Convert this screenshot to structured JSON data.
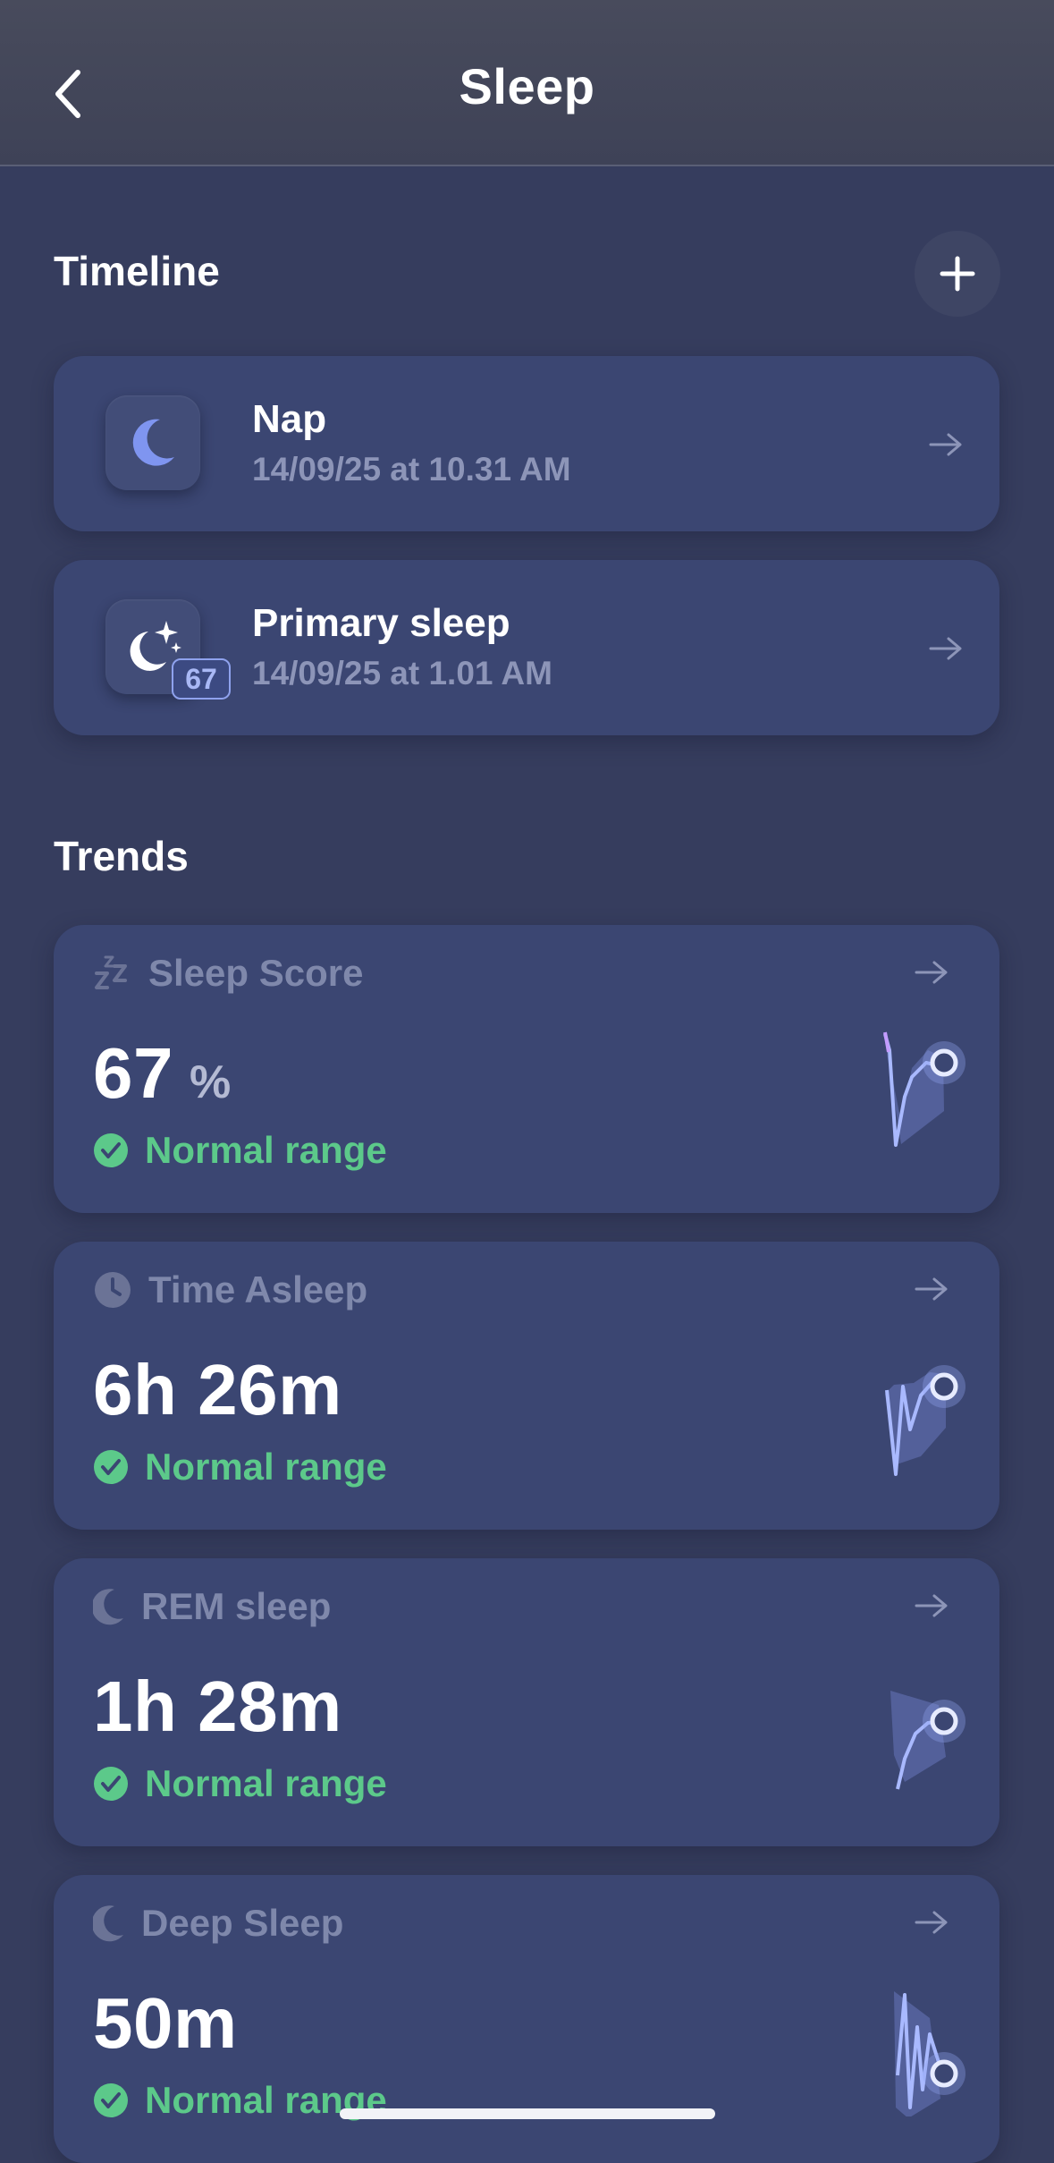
{
  "header": {
    "title": "Sleep"
  },
  "timeline": {
    "title": "Timeline",
    "items": [
      {
        "title": "Nap",
        "subtitle": "14/09/25 at 10.31 AM",
        "icon": "moon-icon"
      },
      {
        "title": "Primary sleep",
        "subtitle": "14/09/25 at 1.01 AM",
        "icon": "moon-stars-icon",
        "badge": "67"
      }
    ]
  },
  "trends": {
    "title": "Trends",
    "items": [
      {
        "label": "Sleep Score",
        "value": "67",
        "unit": "%",
        "status": "Normal range",
        "icon": "zzz-icon"
      },
      {
        "label": "Time Asleep",
        "value": "6h 26m",
        "unit": "",
        "status": "Normal range",
        "icon": "clock-icon"
      },
      {
        "label": "REM sleep",
        "value": "1h 28m",
        "unit": "",
        "status": "Normal range",
        "icon": "moon-icon"
      },
      {
        "label": "Deep Sleep",
        "value": "50m",
        "unit": "",
        "status": "Normal range",
        "icon": "moon-icon"
      }
    ]
  },
  "colors": {
    "background": "#363d5e",
    "card": "#3b4672",
    "accent": "#8fa2ee",
    "status_ok": "#5cc98a"
  }
}
